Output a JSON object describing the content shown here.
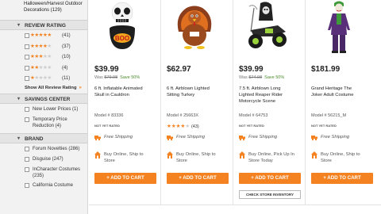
{
  "sidebar": {
    "category_link": "Halloween/Harvest Outdoor Decorations (129)",
    "review_rating": {
      "heading": "REVIEW RATING",
      "rows": [
        {
          "stars": 5,
          "count": "(41)"
        },
        {
          "stars": 4,
          "count": "(37)"
        },
        {
          "stars": 3,
          "count": "(10)"
        },
        {
          "stars": 2,
          "count": "(4)"
        },
        {
          "stars": 1,
          "count": "(11)"
        }
      ],
      "show_all": "Show All Review Rating"
    },
    "savings_center": {
      "heading": "SAVINGS CENTER",
      "options": [
        "New Lower Prices (1)",
        "Temporary Price Reduction (4)"
      ]
    },
    "brand": {
      "heading": "BRAND",
      "options": [
        "Forum Novelties (286)",
        "Disguise (247)",
        "InCharacter Costumes (235)",
        "California Costume"
      ]
    }
  },
  "products": [
    {
      "price": "$39.99",
      "was_label": "Was",
      "was_price": "$79.98",
      "save": "Save 50%",
      "title": "6 ft. Inflatable Animated Skull in Cauldron",
      "model": "Model # 83336",
      "not_rated": "NOT YET RATED",
      "shipping": "Free Shipping",
      "pickup": "Buy Online, Ship to Store",
      "add_to_cart": "ADD TO CART"
    },
    {
      "price": "$62.97",
      "title": "6 ft. Airblown Lighted Sitting Turkey",
      "model": "Model # 25663X",
      "rating_stars": 4,
      "rating_count": "(43)",
      "shipping": "Free Shipping",
      "pickup": "Buy Online, Ship to Store",
      "add_to_cart": "ADD TO CART"
    },
    {
      "price": "$39.99",
      "was_label": "Was",
      "was_price": "$74.98",
      "save": "Save 50%",
      "title": "7.5 ft. Airblown Long Lighted Reaper Rider Motorcycle Scene",
      "model": "Model # 64753",
      "not_rated": "NOT YET RATED",
      "shipping": "Free Shipping",
      "pickup": "Buy Online, Pick Up In Store Today",
      "add_to_cart": "ADD TO CART",
      "check_inventory": "CHECK STORE INVENTORY"
    },
    {
      "price": "$181.99",
      "title": "Grand Heritage The Joker Adult Costume",
      "model": "Model # 56215_M",
      "not_rated": "NOT YET RATED",
      "shipping": "Free Shipping",
      "pickup": "Buy Online, Ship to Store",
      "add_to_cart": "ADD TO CART"
    }
  ],
  "colors": {
    "accent_orange": "#f58220",
    "save_green": "#4a8a2a",
    "sidebar_bg": "#f2f2f2"
  },
  "icons": {
    "shipping": "truck-icon",
    "pickup": "store-pickup-icon",
    "checkbox": "checkbox-icon",
    "star": "star-icon",
    "chevron": "chevron-down-icon"
  }
}
